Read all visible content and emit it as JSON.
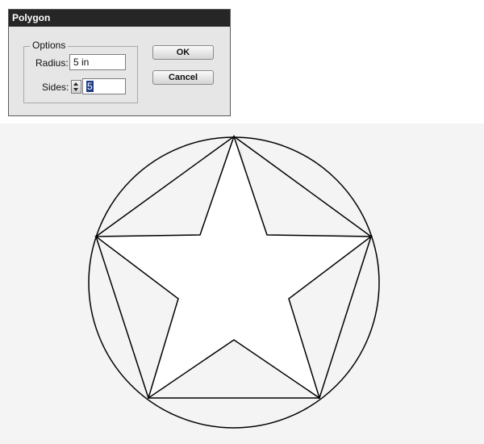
{
  "dialog": {
    "title": "Polygon",
    "options_label": "Options",
    "radius_label": "Radius:",
    "radius_value": "5 in",
    "sides_label": "Sides:",
    "sides_value": "5",
    "ok_label": "OK",
    "cancel_label": "Cancel"
  },
  "artwork": {
    "shapes": [
      "circle",
      "pentagon",
      "star"
    ],
    "stroke_color": "#000000",
    "canvas_color": "#f4f4f4",
    "star_fill": "#ffffff"
  }
}
